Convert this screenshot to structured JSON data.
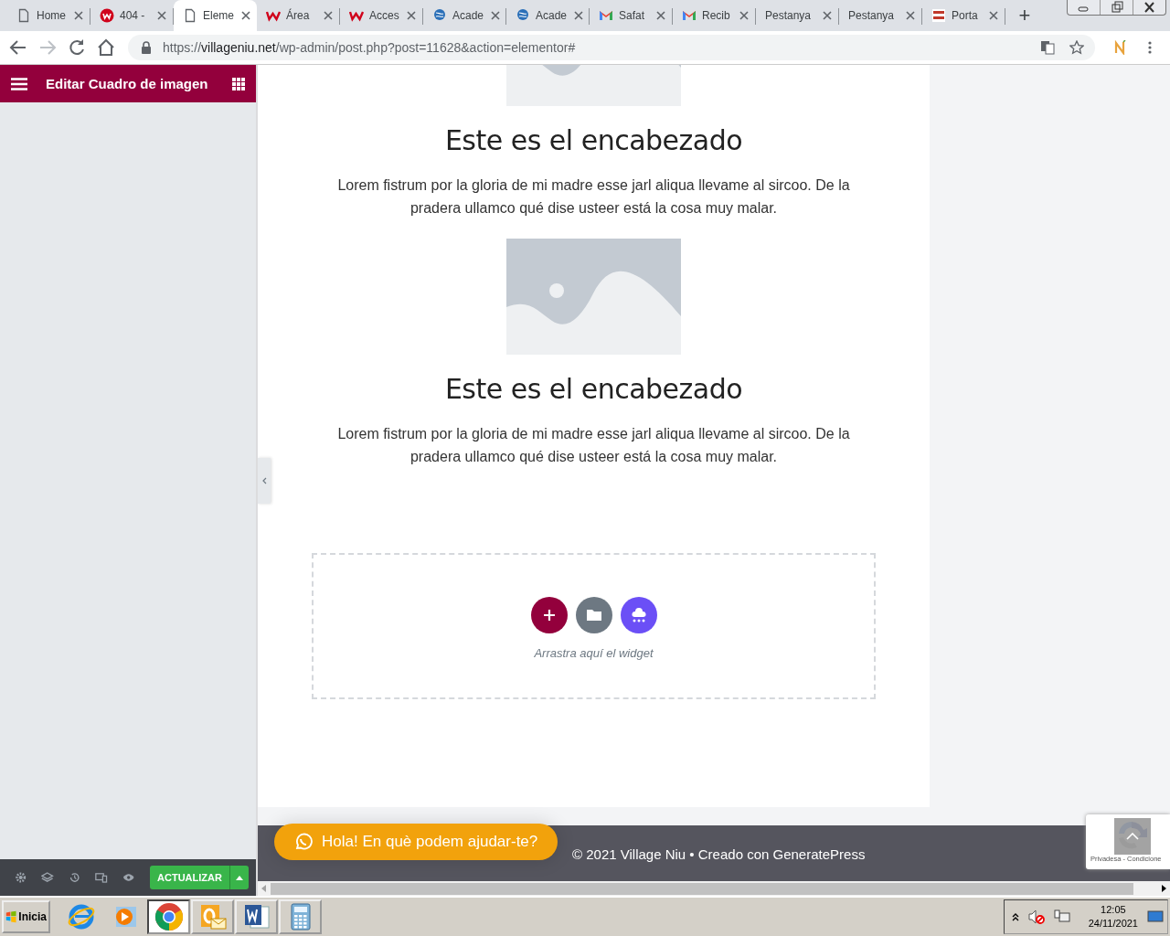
{
  "browser": {
    "tabs": [
      {
        "label": "Home",
        "kind": "page",
        "selected": false
      },
      {
        "label": "404 -",
        "kind": "circle",
        "selected": false
      },
      {
        "label": "Eleme",
        "kind": "page",
        "selected": true
      },
      {
        "label": "Área",
        "kind": "logo",
        "selected": false
      },
      {
        "label": "Acces",
        "kind": "logo",
        "selected": false
      },
      {
        "label": "Acade",
        "kind": "globe",
        "selected": false
      },
      {
        "label": "Acade",
        "kind": "globe",
        "selected": false
      },
      {
        "label": "Safat",
        "kind": "mail",
        "selected": false
      },
      {
        "label": "Recib",
        "kind": "mail",
        "selected": false
      },
      {
        "label": "Pestanya",
        "kind": "plain",
        "selected": false
      },
      {
        "label": "Pestanya",
        "kind": "plain",
        "selected": false
      },
      {
        "label": "Porta",
        "kind": "square",
        "selected": false
      }
    ],
    "new_tab": "+",
    "address": {
      "scheme": "https://",
      "host": "villageniu.net",
      "path": "/wp-admin/post.php?post=11628&action=elementor#"
    }
  },
  "editor": {
    "panel_title": "Editar Cuadro de imagen",
    "update_button": "ACTUALIZAR"
  },
  "page": {
    "blocks": [
      {
        "kind": "image_cut"
      },
      {
        "kind": "heading",
        "text": "Este es el encabezado"
      },
      {
        "kind": "text",
        "text": "Lorem fistrum por la gloria de mi madre esse jarl aliqua llevame al sircoo. De la pradera ullamco qué dise usteer está la cosa muy malar."
      },
      {
        "kind": "image"
      },
      {
        "kind": "heading",
        "text": "Este es el encabezado"
      },
      {
        "kind": "text",
        "text": "Lorem fistrum por la gloria de mi madre esse jarl aliqua llevame al sircoo. De la pradera ullamco qué dise usteer está la cosa muy malar."
      }
    ],
    "drop_zone": {
      "hint": "Arrastra aquí el widget"
    },
    "chat_button": "Hola! En què podem ajudar-te?",
    "footer": "© 2021 Village Niu • Creado con GeneratePress",
    "recaptcha": "Privadesa - Condicione"
  },
  "taskbar": {
    "start": "Inicia",
    "apps": [
      {
        "kind": "browser-e",
        "selected": false
      },
      {
        "kind": "player",
        "selected": false
      },
      {
        "kind": "chrome",
        "selected": true
      },
      {
        "kind": "mail",
        "selected": false
      },
      {
        "kind": "word",
        "selected": false
      },
      {
        "kind": "calculator",
        "selected": false
      }
    ],
    "time": "12:05",
    "date": "24/11/2021"
  }
}
